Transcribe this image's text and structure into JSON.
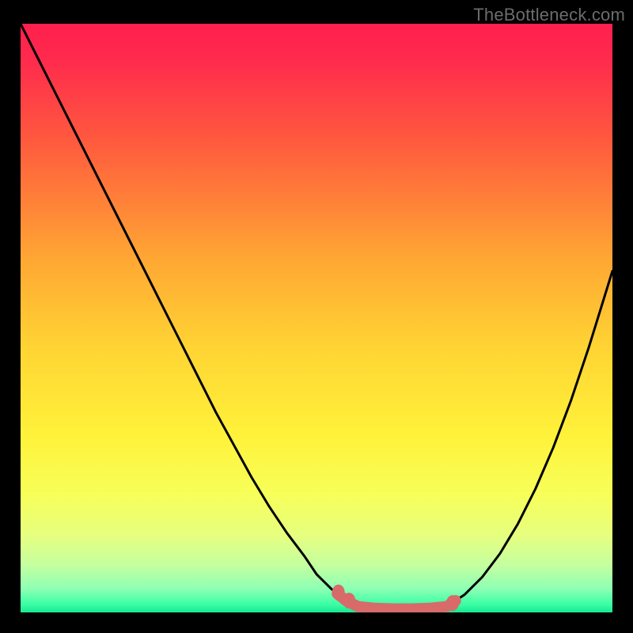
{
  "watermark": "TheBottleneck.com",
  "colors": {
    "background": "#000000",
    "watermark_text": "#6c6c6c",
    "curve": "#000000",
    "highlight": "#d86a6a",
    "gradient_stops": [
      {
        "offset": 0.0,
        "color": "#ff1f4d"
      },
      {
        "offset": 0.06,
        "color": "#ff2a4d"
      },
      {
        "offset": 0.2,
        "color": "#ff5a3e"
      },
      {
        "offset": 0.4,
        "color": "#ffa733"
      },
      {
        "offset": 0.55,
        "color": "#ffd433"
      },
      {
        "offset": 0.7,
        "color": "#fff23a"
      },
      {
        "offset": 0.8,
        "color": "#f7ff59"
      },
      {
        "offset": 0.87,
        "color": "#e6ff80"
      },
      {
        "offset": 0.92,
        "color": "#c4ffa0"
      },
      {
        "offset": 0.96,
        "color": "#8dffb4"
      },
      {
        "offset": 0.985,
        "color": "#3fffa6"
      },
      {
        "offset": 1.0,
        "color": "#17e890"
      }
    ]
  },
  "chart_data": {
    "type": "line",
    "title": "",
    "xlabel": "",
    "ylabel": "",
    "xlim": [
      0,
      100
    ],
    "ylim": [
      0,
      100
    ],
    "grid": false,
    "series": [
      {
        "name": "left-curve",
        "x": [
          0,
          3,
          6,
          9,
          12,
          15,
          18,
          21,
          24,
          27,
          30,
          33,
          36,
          39,
          42,
          45,
          48,
          50,
          52.5,
          55,
          57
        ],
        "y": [
          100,
          94,
          88,
          82,
          76,
          70,
          64,
          58,
          52,
          46,
          40,
          34,
          28.5,
          23,
          18,
          13.5,
          9.5,
          6.5,
          4,
          2,
          1
        ]
      },
      {
        "name": "flat-bottom",
        "x": [
          57,
          60,
          63,
          66,
          69,
          72
        ],
        "y": [
          1,
          0.7,
          0.6,
          0.6,
          0.7,
          1
        ]
      },
      {
        "name": "right-curve",
        "x": [
          72,
          75,
          78,
          81,
          84,
          87,
          90,
          93,
          96,
          100
        ],
        "y": [
          1,
          3,
          6,
          10,
          15,
          21,
          28,
          36,
          45,
          58
        ]
      }
    ],
    "highlight_segment": {
      "name": "optimal-zone",
      "x": [
        53.5,
        55,
        57,
        60,
        63,
        66,
        69,
        72,
        73.5
      ],
      "y": [
        3.2,
        2,
        1,
        0.7,
        0.6,
        0.6,
        0.7,
        1,
        2
      ]
    },
    "highlight_markers": [
      {
        "x": 53.7,
        "y": 3.4
      },
      {
        "x": 55.5,
        "y": 2.0
      },
      {
        "x": 73.0,
        "y": 1.6
      }
    ]
  }
}
